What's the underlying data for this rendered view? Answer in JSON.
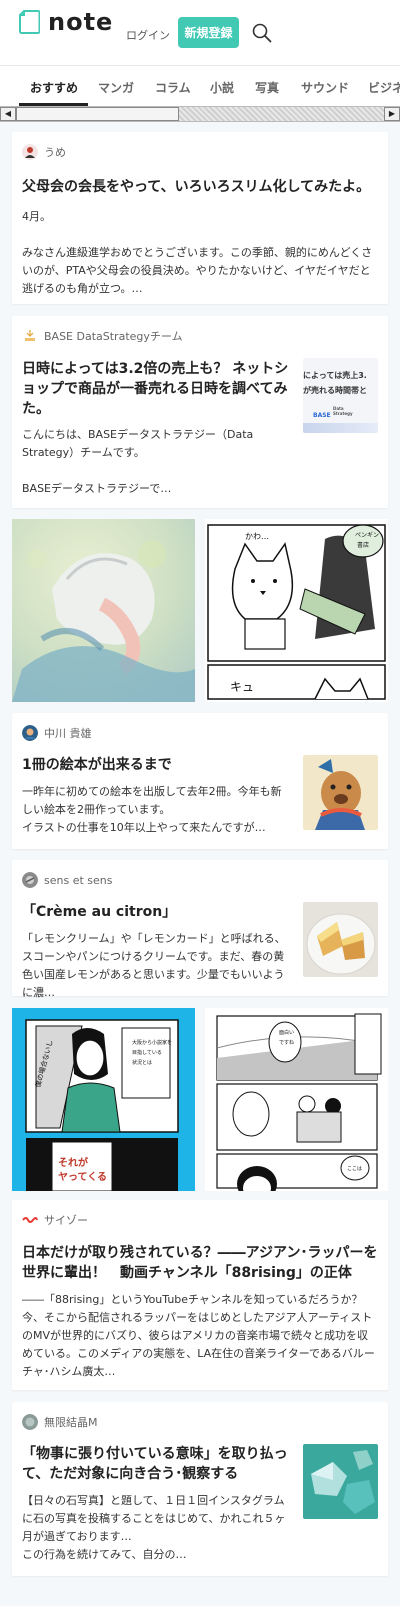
{
  "header": {
    "logo_text": "note",
    "login_label": "ログイン",
    "signup_label": "新規登録",
    "brand_color": "#41c9b4"
  },
  "tabs": [
    {
      "label": "おすすめ",
      "active": true
    },
    {
      "label": "マンガ"
    },
    {
      "label": "コラム"
    },
    {
      "label": "小説"
    },
    {
      "label": "写真"
    },
    {
      "label": "サウンド"
    },
    {
      "label": "ビジネス"
    }
  ],
  "cards": [
    {
      "author": "うめ",
      "title": "父母会の会長をやって、いろいろスリム化してみたよ。",
      "body": "4月。\n\nみなさん進級進学おめでとうございます。この季節、親的にめんどくさいのが、PTAや父母会の役員決め。やりたかないけど、イヤだイヤだと逃げるのも角が立つ。…"
    },
    {
      "author": "BASE DataStrategyチーム",
      "title": "日時によっては3.2倍の売上も？ ネットショップで商品が一番売れる日時を調べてみた。",
      "body": "こんにちは、BASEデータストラテジー（Data Strategy）チームです。\n\nBASEデータストラテジーで…",
      "thumb_text_1": "によっては売上3.",
      "thumb_text_2": "が売れる時間帯と",
      "thumb_brand": "BASE",
      "thumb_brand_sub": "Data\nStrategy"
    },
    {
      "author": "中川 貴雄",
      "title": "1冊の絵本が出来るまで",
      "body": "一昨年に初めての絵本を出版して去年2冊。今年も新しい絵本を2冊作っています。\nイラストの仕事を10年以上やって来たんですが…"
    },
    {
      "author": "sens et sens",
      "title": "「Crème au citron」",
      "body": "「レモンクリーム」や「レモンカード」と呼ばれる、スコーンやパンにつけるクリームです。まだ、春の黄色い国産レモンがあると思います。少量でもいいように濃…"
    },
    {
      "author": "サイゾー",
      "title": "日本だけが取り残されている？――アジアン･ラッパーを世界に輩出！　動画チャンネル「88rising」の正体",
      "body": "――「88rising」というYouTubeチャンネルを知っているだろうか？今、そこから配信されるラッパーをはじめとしたアジア人アーティストのMVが世界的にバズり、彼らはアメリカの音楽市場で続々と成功を収めている。このメディアの実態を、LA在住の音楽ライターであるバルーチャ･ハシム廣太…"
    },
    {
      "author": "無限結晶M",
      "title": "「物事に張り付いている意味」を取り払って、ただ対象に向き合う･観察する",
      "body": "【日々の石写真】と題して、１日１回インスタグラムに石の写真を投稿することをはじめて、かれこれ５ヶ月が過ぎております…\nこの行為を続けてみて、自分の…"
    }
  ],
  "manga_texts": {
    "tile2_badge": "ペンギン\n書店",
    "tile2_sfx": "キュ",
    "tile2_bubble": "かわ…\nいい…",
    "tile3_vertical": "僕の場合ないし",
    "tile3_box1": "大阪から小説家を\n目指している\n状況とは\n小説をいかにおろ",
    "tile3_box2": "それが\nヤってくる",
    "tile4_top": "面\n白\nい\nで\nす\nね",
    "tile4_right": "ここは\nお前\n…"
  },
  "colors": {
    "accent": "#41c9b4",
    "background": "#f5f8fa",
    "manga_blue": "#1fb4e8"
  }
}
